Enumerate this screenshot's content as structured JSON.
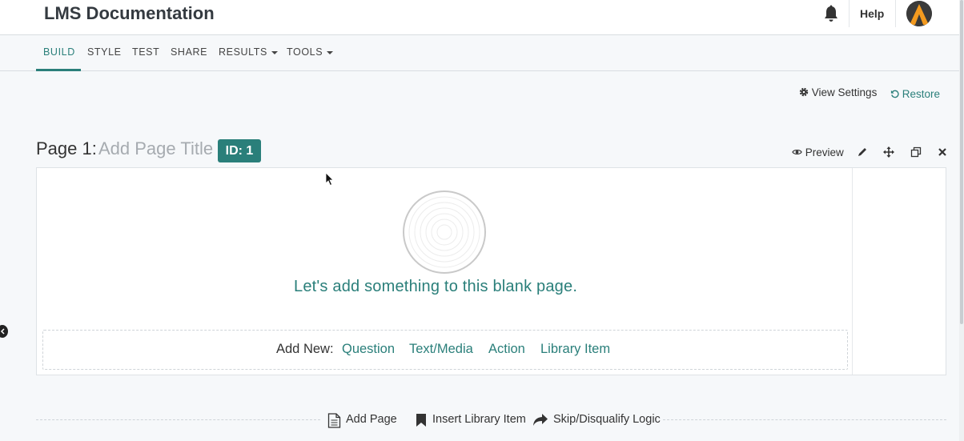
{
  "header": {
    "app_title": "LMS Documentation",
    "help_label": "Help",
    "bell_icon": "bell-icon",
    "avatar_icon": "avatar-logo"
  },
  "nav": {
    "tabs": [
      {
        "label": "BUILD",
        "active": true
      },
      {
        "label": "STYLE",
        "active": false
      },
      {
        "label": "TEST",
        "active": false
      },
      {
        "label": "SHARE",
        "active": false
      },
      {
        "label": "RESULTS",
        "active": false,
        "dropdown": true
      },
      {
        "label": "TOOLS",
        "active": false,
        "dropdown": true
      }
    ]
  },
  "settings": {
    "view_settings_label": "View Settings",
    "restore_label": "Restore"
  },
  "page": {
    "label": "Page 1:",
    "title_placeholder": "Add Page Title",
    "id_badge": "ID: 1",
    "preview_label": "Preview",
    "toolbar_icons": [
      "pencil-icon",
      "move-icon",
      "copy-icon",
      "close-icon"
    ]
  },
  "card": {
    "blank_message": "Let's add something to this blank page.",
    "add_new_label": "Add New:",
    "add_new_links": [
      "Question",
      "Text/Media",
      "Action",
      "Library Item"
    ]
  },
  "bottom_actions": [
    {
      "label": "Add Page",
      "icon": "document-icon"
    },
    {
      "label": "Insert Library Item",
      "icon": "bookmark-icon"
    },
    {
      "label": "Skip/Disqualify Logic",
      "icon": "share-arrow-icon"
    }
  ],
  "colors": {
    "accent": "#2a7f7a",
    "background": "#f6f8fa",
    "placeholder": "#a6abb0"
  }
}
